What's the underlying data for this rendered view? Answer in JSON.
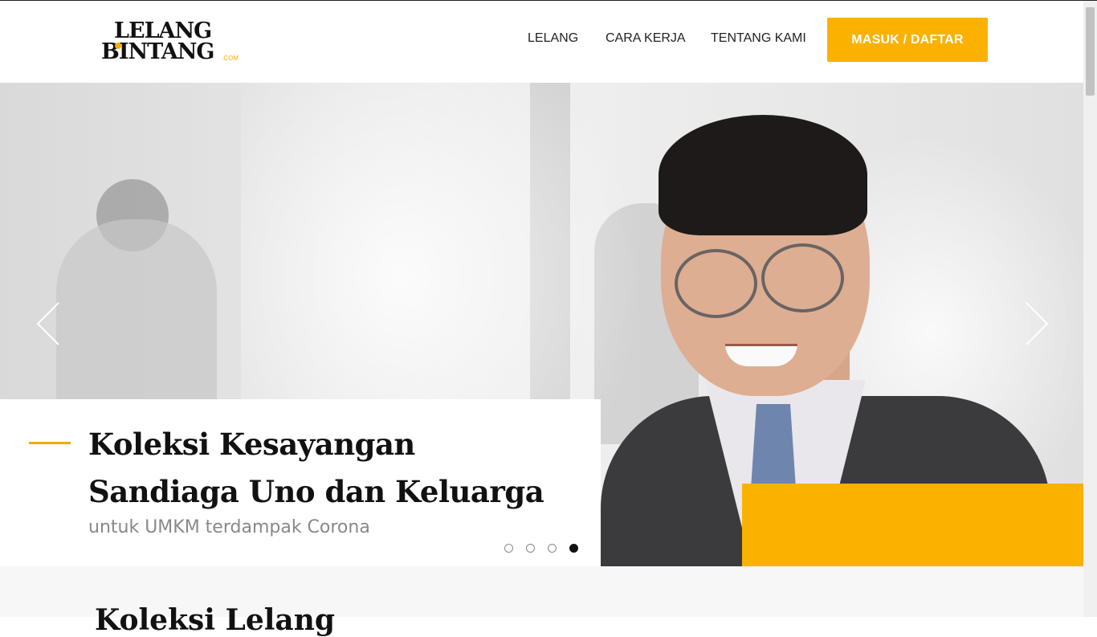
{
  "brand": {
    "logo_line1": "LELANG",
    "logo_line2": "BINTANG",
    "logo_suffix": ".COM",
    "accent_color": "#fbb100"
  },
  "nav": {
    "items": [
      {
        "label": "LELANG"
      },
      {
        "label": "CARA KERJA"
      },
      {
        "label": "TENTANG KAMI"
      }
    ],
    "login_label": "MASUK / DAFTAR"
  },
  "hero": {
    "title": "Koleksi Kesayangan Sandiaga Uno dan Keluarga",
    "subtitle": "untuk UMKM terdampak Corona",
    "slides_total": 4,
    "active_slide": 4,
    "prev_icon": "chevron-left-icon",
    "next_icon": "chevron-right-icon"
  },
  "section": {
    "heading": "Koleksi Lelang"
  }
}
